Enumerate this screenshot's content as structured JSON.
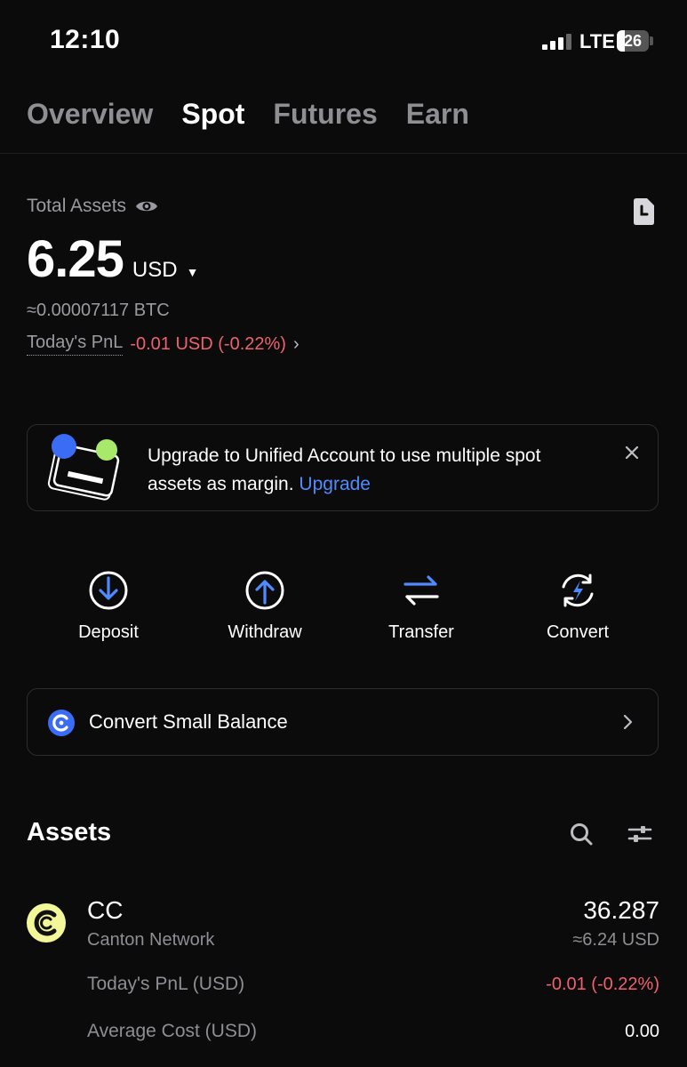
{
  "status_bar": {
    "time": "12:10",
    "network": "LTE",
    "battery": "26"
  },
  "tabs": [
    {
      "label": "Overview",
      "active": false
    },
    {
      "label": "Spot",
      "active": true
    },
    {
      "label": "Futures",
      "active": false
    },
    {
      "label": "Earn",
      "active": false
    }
  ],
  "summary": {
    "label": "Total Assets",
    "amount": "6.25",
    "currency": "USD",
    "btc_equivalent": "≈0.00007117 BTC",
    "pnl_label": "Today's PnL",
    "pnl_value": "-0.01 USD (-0.22%)"
  },
  "banner": {
    "text": "Upgrade to Unified Account to use multiple spot assets as margin.",
    "link": "Upgrade"
  },
  "actions": [
    {
      "label": "Deposit",
      "icon": "deposit-icon"
    },
    {
      "label": "Withdraw",
      "icon": "withdraw-icon"
    },
    {
      "label": "Transfer",
      "icon": "transfer-icon"
    },
    {
      "label": "Convert",
      "icon": "convert-icon"
    }
  ],
  "convert_small_balance": {
    "label": "Convert Small Balance"
  },
  "assets": {
    "title": "Assets",
    "items": [
      {
        "symbol": "CC",
        "name": "Canton Network",
        "amount": "36.287",
        "usd_value": "≈6.24 USD",
        "pnl_label": "Today's PnL (USD)",
        "pnl_value": "-0.01 (-0.22%)",
        "avg_cost_label": "Average Cost (USD)",
        "avg_cost_value": "0.00"
      }
    ]
  },
  "colors": {
    "accent": "#4f8bff",
    "negative": "#f0616d",
    "background": "#0b0b0c"
  }
}
